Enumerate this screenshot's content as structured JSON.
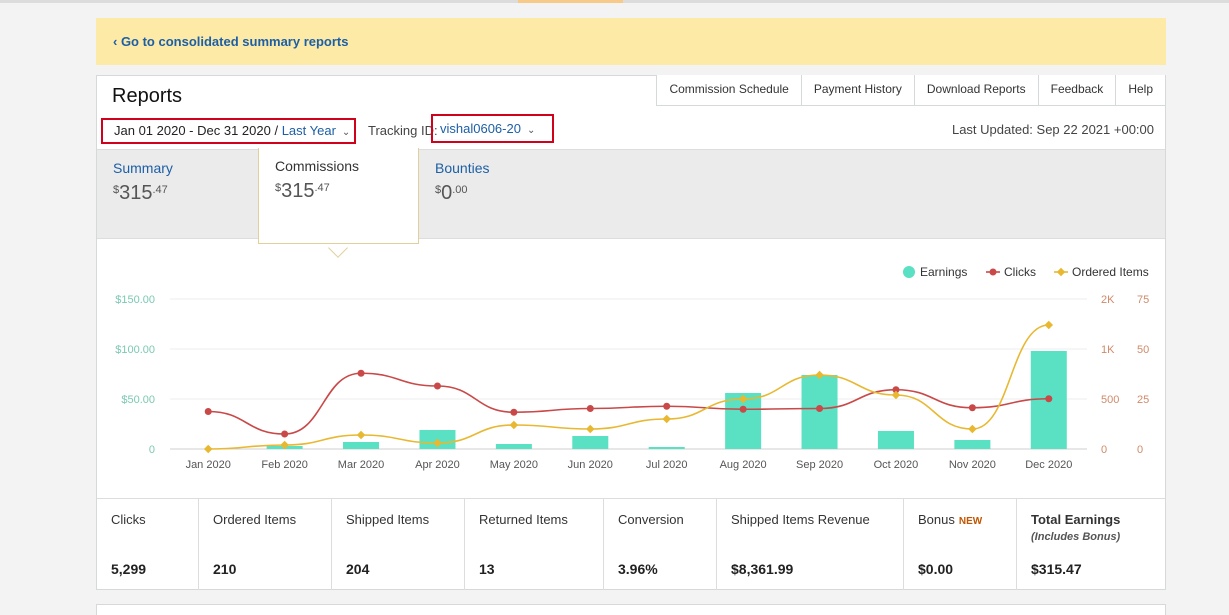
{
  "banner": {
    "link": "‹ Go to consolidated summary reports"
  },
  "reports": {
    "title": "Reports",
    "tabs": [
      "Commission Schedule",
      "Payment History",
      "Download Reports",
      "Feedback",
      "Help"
    ],
    "date_range": "Jan 01 2020 - Dec 31 2020 / ",
    "date_preset": "Last Year",
    "tracking_label": "Tracking ID:",
    "tracking_id": "vishal0606-20",
    "last_updated": "Last Updated: Sep 22 2021 +00:00"
  },
  "summary": [
    {
      "label": "Summary",
      "dollar": "$",
      "whole": "315",
      "cents": ".47"
    },
    {
      "label": "Commissions",
      "dollar": "$",
      "whole": "315",
      "cents": ".47"
    },
    {
      "label": "Bounties",
      "dollar": "$",
      "whole": "0",
      "cents": ".00"
    }
  ],
  "chart_data": {
    "type": "bar",
    "categories": [
      "Jan 2020",
      "Feb 2020",
      "Mar 2020",
      "Apr 2020",
      "May 2020",
      "Jun 2020",
      "Jul 2020",
      "Aug 2020",
      "Sep 2020",
      "Oct 2020",
      "Nov 2020",
      "Dec 2020"
    ],
    "series": [
      {
        "name": "Earnings",
        "type": "bar",
        "axis": "left",
        "color": "#5ae0c2",
        "values": [
          0,
          3,
          7,
          19,
          5,
          13,
          2,
          56,
          74,
          18,
          9,
          98
        ]
      },
      {
        "name": "Clicks",
        "type": "line",
        "axis": "right1",
        "color": "#c94848",
        "values": [
          500,
          200,
          1010,
          840,
          490,
          540,
          570,
          530,
          540,
          790,
          550,
          670
        ]
      },
      {
        "name": "Ordered Items",
        "type": "line",
        "axis": "right2",
        "color": "#e8b830",
        "values": [
          0,
          2,
          7,
          3,
          12,
          10,
          15,
          25,
          37,
          27,
          10,
          62
        ]
      }
    ],
    "axes": {
      "left": {
        "range": [
          0,
          150
        ],
        "ticks": [
          "0",
          "$50.00",
          "$100.00",
          "$150.00"
        ]
      },
      "right1": {
        "range": [
          0,
          2000
        ],
        "ticks": [
          "0",
          "500",
          "1K",
          "2K"
        ]
      },
      "right2": {
        "range": [
          0,
          75
        ],
        "ticks": [
          "0",
          "25",
          "50",
          "75"
        ]
      }
    },
    "legend": "top-right",
    "grid": true
  },
  "metrics": [
    {
      "label": "Clicks",
      "value": "5,299"
    },
    {
      "label": "Ordered Items",
      "value": "210"
    },
    {
      "label": "Shipped Items",
      "value": "204"
    },
    {
      "label": "Returned Items",
      "value": "13"
    },
    {
      "label": "Conversion",
      "value": "3.96%"
    },
    {
      "label": "Shipped Items Revenue",
      "value": "$8,361.99"
    },
    {
      "label": "Bonus",
      "badge": "NEW",
      "value": "$0.00"
    },
    {
      "label": "Total Earnings",
      "sub": "(Includes Bonus)",
      "value": "$315.47"
    }
  ]
}
